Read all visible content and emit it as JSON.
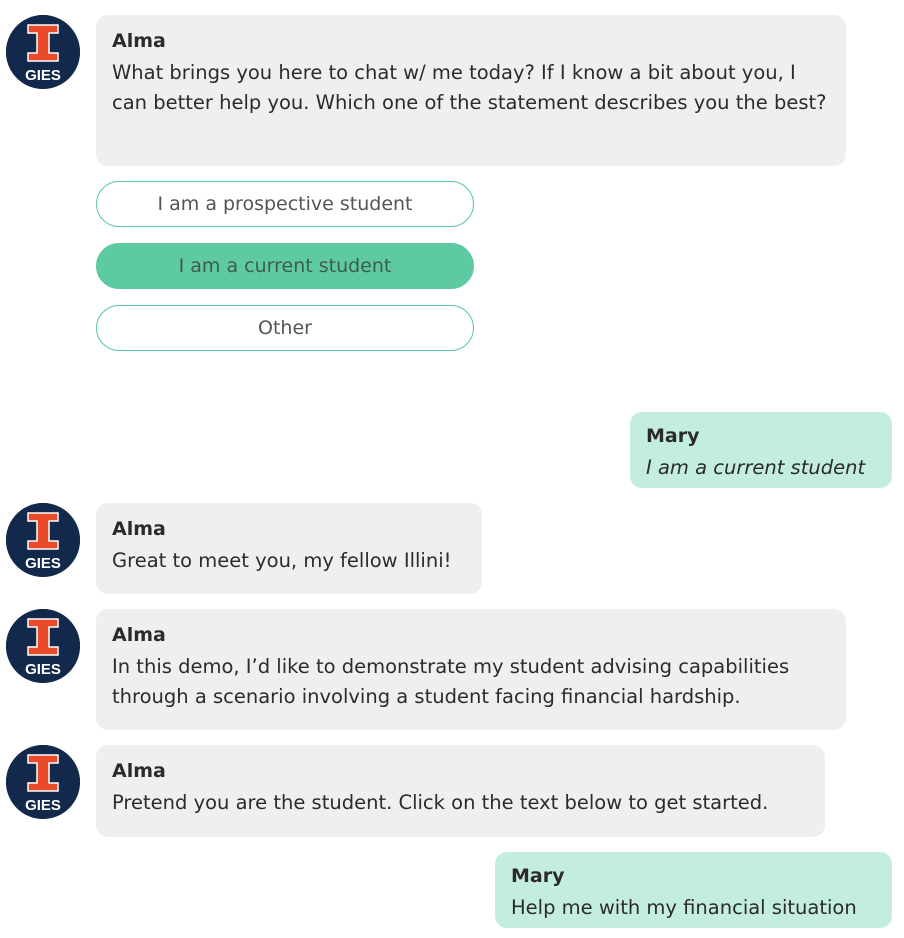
{
  "brand": {
    "avatar_text": "GIES",
    "avatar_bg": "#13294b",
    "avatar_accent": "#e84a27"
  },
  "colors": {
    "bot_bubble": "#efefef",
    "user_bubble": "#c3ede0",
    "option_border": "#5ecaa2",
    "option_selected": "#5ecaa2"
  },
  "messages": [
    {
      "sender": "Alma",
      "text": "What brings you here to chat w/ me today? If I know a bit about you, I can better help you. Which one of the statement describes you the best?"
    },
    {
      "sender": "Mary",
      "text": "I am a current student"
    },
    {
      "sender": "Alma",
      "text": "Great to meet you, my fellow Illini!"
    },
    {
      "sender": "Alma",
      "text": "In this demo, I’d like to demonstrate my student advising capabilities through a scenario involving a student facing financial hardship."
    },
    {
      "sender": "Alma",
      "text": "Pretend you are the student. Click on the text below to get started."
    },
    {
      "sender": "Mary",
      "text": "Help me with my financial situation"
    }
  ],
  "options": [
    {
      "label": "I am a prospective student",
      "selected": false
    },
    {
      "label": "I am a current student",
      "selected": true
    },
    {
      "label": "Other",
      "selected": false
    }
  ]
}
